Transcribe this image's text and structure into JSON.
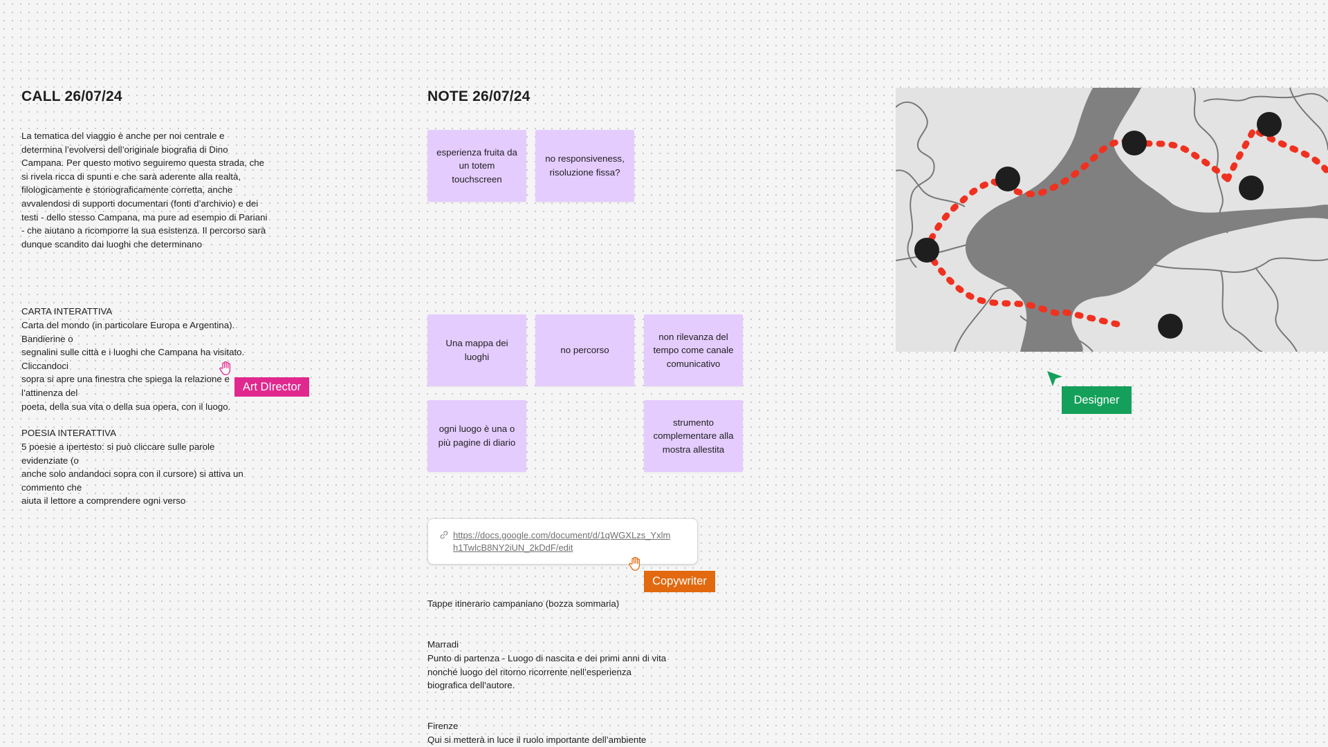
{
  "call": {
    "title": "CALL 26/07/24",
    "intro": "La tematica del viaggio è anche per noi centrale e\ndetermina l’evolversi dell’originale biografia di Dino\nCampana. Per questo motivo seguiremo questa strada, che\nsi rivela ricca di spunti e che sarà aderente alla realtà,\nfilologicamente e storiograficamente corretta, anche\navvalendosi di supporti documentari (fonti d’archivio) e dei\ntesti - dello stesso Campana, ma pure ad esempio di Pariani\n- che aiutano a ricomporre la sua esistenza. Il percorso sarà\ndunque scandito dai luoghi che determinano",
    "carta_heading": "CARTA INTERATTIVA",
    "carta_body": "Carta del mondo (in particolare Europa e Argentina).\nBandierine o\nsegnalini sulle città e i luoghi che Campana ha visitato.\nCliccandoci\nsopra si apre una finestra che spiega la relazione e\nl’attinenza del\npoeta, della sua vita o della sua opera, con il luogo.",
    "poesia_heading": "POESIA INTERATTIVA",
    "poesia_body": "  5 poesie a ipertesto: si può cliccare sulle parole\nevidenziate (o\nanche solo andandoci sopra con il cursore) si attiva un\ncommento che\naiuta il lettore a comprendere ogni verso"
  },
  "note": {
    "title": "NOTE 26/07/24",
    "stickies": [
      "esperienza fruita da un totem touchscreen",
      "no responsiveness, risoluzione fissa?",
      "Una mappa dei luoghi",
      "no percorso",
      "non rilevanza del tempo come canale comunicativo",
      "ogni luogo è una o più pagine di diario",
      "strumento complementare alla mostra allestita"
    ],
    "sticky_color": "#e4ccff",
    "link_url": "https://docs.google.com/document/d/1qWGXLzs_Yxlmh1TwlcB8NY2iUN_2kDdF/edit",
    "link_icon": "link-icon",
    "itinerary_title": "Tappe itinerario campaniano (bozza sommaria)",
    "marradi_name": "Marradi",
    "marradi_desc": "Punto di partenza - Luogo di nascita e dei primi anni di vita\nnonché luogo del ritorno ricorrente nell’esperienza\nbiografica dell’autore.",
    "firenze_name": "Firenze",
    "firenze_desc": "Qui si metterà in luce il ruolo importante dell’ambiente"
  },
  "collaborators": [
    {
      "name": "Art DIrector",
      "color": "#e0288e",
      "cursor": "hand-cursor-icon"
    },
    {
      "name": "Copywriter",
      "color": "#e2690f",
      "cursor": "hand-cursor-icon"
    },
    {
      "name": "Designer",
      "color": "#14a05a",
      "cursor": "arrow-cursor-icon"
    }
  ],
  "map": {
    "background": "#e3e3e3",
    "lake_color": "#808080",
    "route_color": "#f0311f",
    "marker_color": "#1e1e1e"
  }
}
